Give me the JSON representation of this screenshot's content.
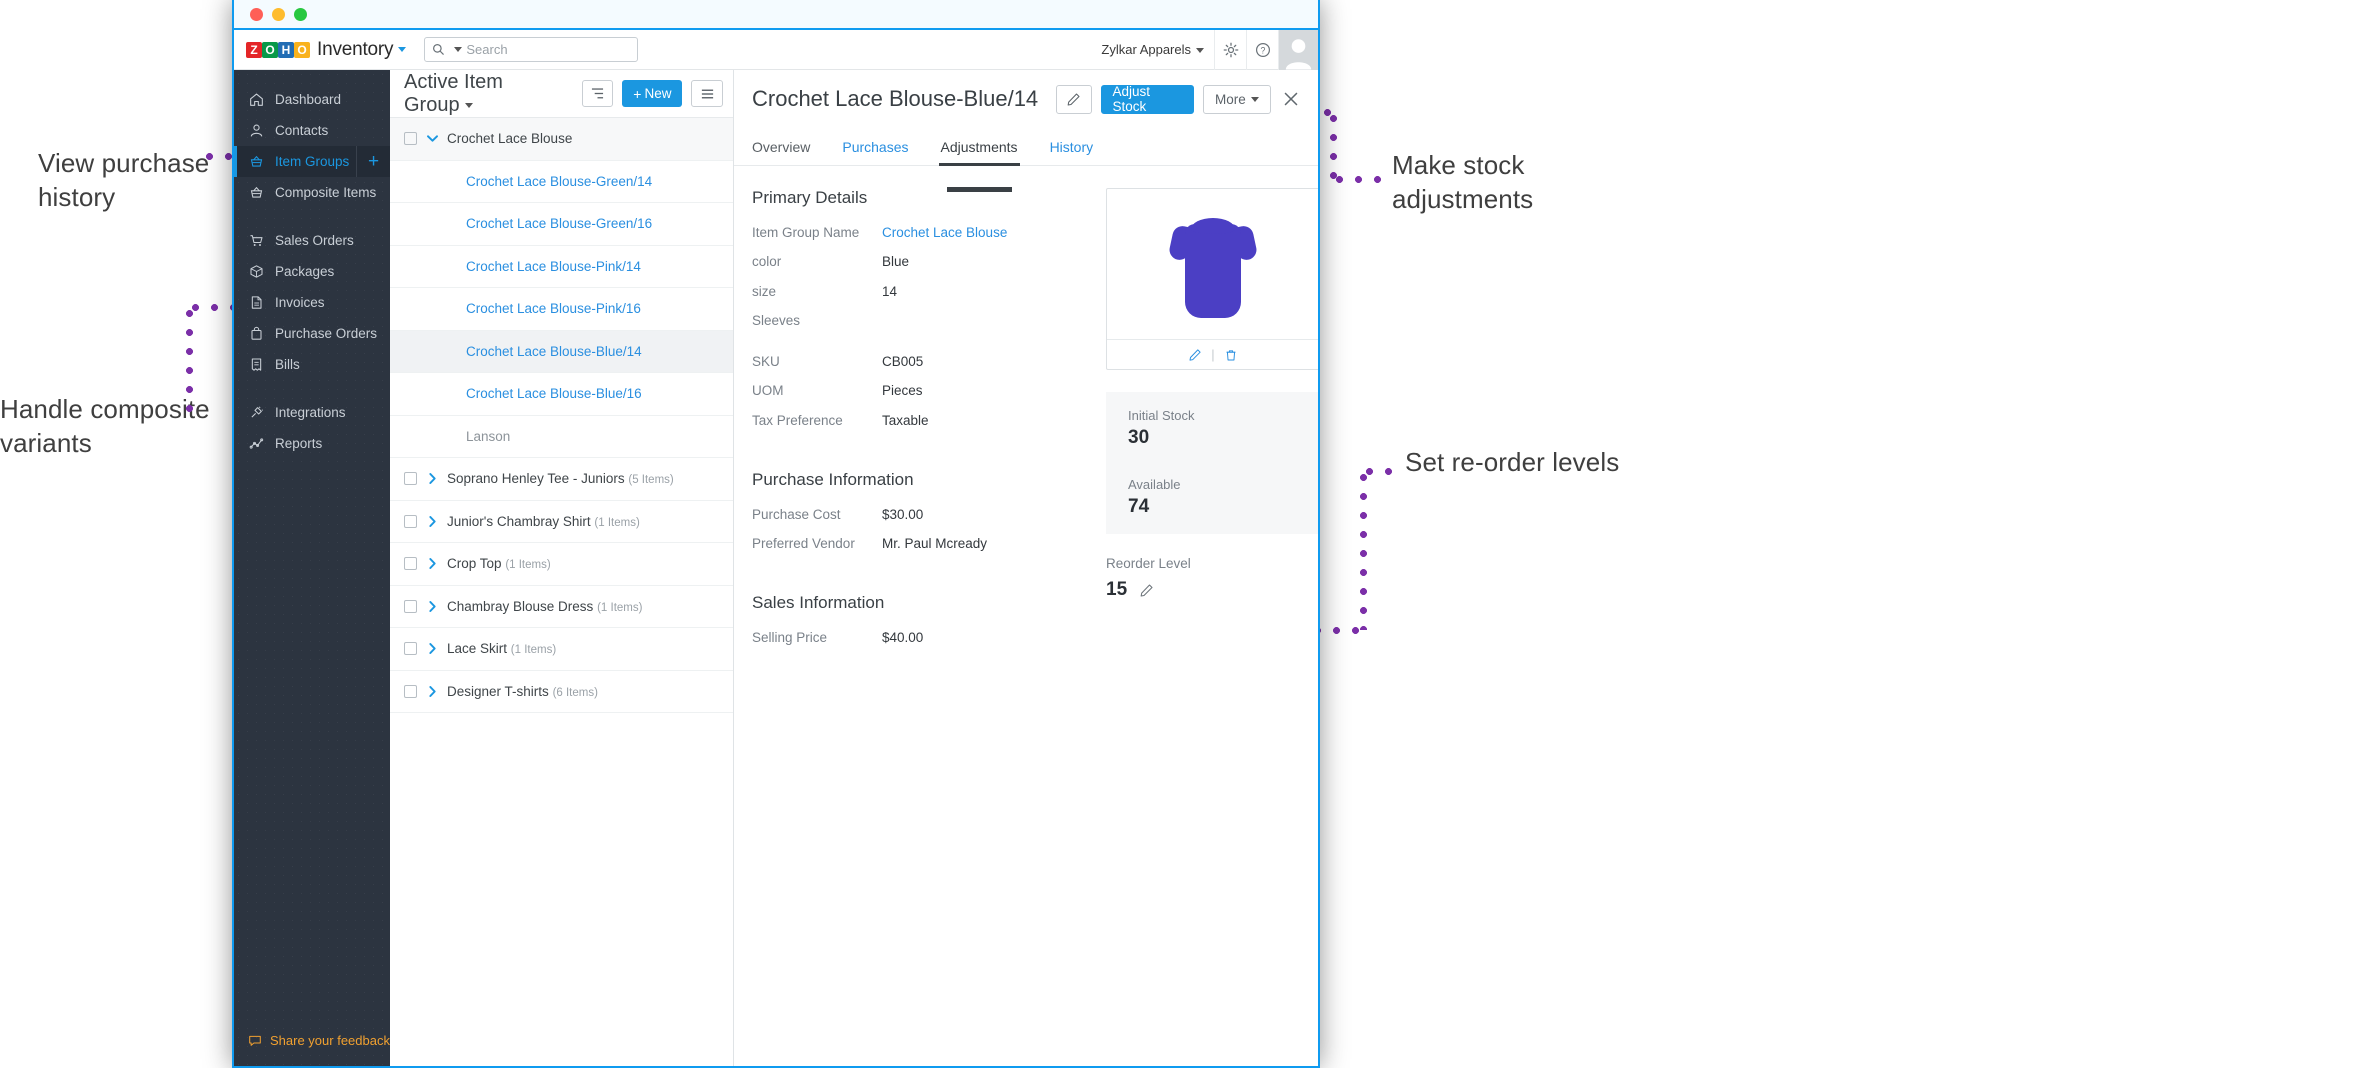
{
  "window": {
    "titlebar_buttons": [
      "close",
      "minimize",
      "maximize"
    ]
  },
  "appbar": {
    "logo_letters": [
      "Z",
      "O",
      "H",
      "O"
    ],
    "app_name": "Inventory",
    "search_placeholder": "Search",
    "org_name": "Zylkar Apparels",
    "icons": [
      "gear-icon",
      "help-icon",
      "avatar"
    ]
  },
  "sidebar": {
    "items": [
      {
        "label": "Dashboard",
        "icon": "home-icon",
        "active": false
      },
      {
        "label": "Contacts",
        "icon": "person-icon",
        "active": false
      },
      {
        "label": "Item Groups",
        "icon": "basket-icon",
        "active": true,
        "add_label": "+"
      },
      {
        "label": "Composite Items",
        "icon": "basket-icon",
        "active": false
      },
      {
        "label": "Sales Orders",
        "icon": "cart-icon",
        "active": false
      },
      {
        "label": "Packages",
        "icon": "box-icon",
        "active": false
      },
      {
        "label": "Invoices",
        "icon": "document-icon",
        "active": false
      },
      {
        "label": "Purchase Orders",
        "icon": "bag-icon",
        "active": false
      },
      {
        "label": "Bills",
        "icon": "receipt-icon",
        "active": false
      },
      {
        "label": "Integrations",
        "icon": "plug-icon",
        "active": false
      },
      {
        "label": "Reports",
        "icon": "chart-icon",
        "active": false
      }
    ],
    "feedback_label": "Share your feedback"
  },
  "list_panel": {
    "title": "Active Item Group",
    "new_button": "New",
    "rows": [
      {
        "name": "Crochet Lace Blouse",
        "type": "group-head",
        "checkbox": true,
        "expanded": true,
        "link": false
      },
      {
        "name": "Crochet Lace Blouse-Green/14",
        "type": "variant",
        "link": true
      },
      {
        "name": "Crochet Lace Blouse-Green/16",
        "type": "variant",
        "link": true
      },
      {
        "name": "Crochet Lace Blouse-Pink/14",
        "type": "variant",
        "link": true
      },
      {
        "name": "Crochet Lace Blouse-Pink/16",
        "type": "variant",
        "link": true
      },
      {
        "name": "Crochet Lace Blouse-Blue/14",
        "type": "variant",
        "link": true,
        "selected": true
      },
      {
        "name": "Crochet Lace Blouse-Blue/16",
        "type": "variant",
        "link": true
      },
      {
        "name": "Lanson",
        "type": "muted",
        "link": false
      },
      {
        "name": "Soprano Henley Tee - Juniors",
        "count": "(5 Items)",
        "type": "group",
        "checkbox": true,
        "link": false
      },
      {
        "name": "Junior's Chambray Shirt",
        "count": "(1 Items)",
        "type": "group",
        "checkbox": true,
        "link": false
      },
      {
        "name": "Crop Top",
        "count": "(1 Items)",
        "type": "group",
        "checkbox": true,
        "link": false
      },
      {
        "name": "Chambray Blouse Dress",
        "count": "(1 Items)",
        "type": "group",
        "checkbox": true,
        "link": false
      },
      {
        "name": "Lace Skirt",
        "count": "(1 Items)",
        "type": "group",
        "checkbox": true,
        "link": false
      },
      {
        "name": "Designer T-shirts",
        "count": "(6 Items)",
        "type": "group",
        "checkbox": true,
        "link": false
      }
    ]
  },
  "detail": {
    "title": "Crochet Lace Blouse-Blue/14",
    "edit_button": "edit-pencil",
    "adjust_stock_button": "Adjust Stock",
    "more_button": "More",
    "close_button": "close",
    "tabs": [
      {
        "label": "Overview",
        "active": false
      },
      {
        "label": "Purchases",
        "active": false
      },
      {
        "label": "Adjustments",
        "active": true
      },
      {
        "label": "History",
        "active": false
      }
    ],
    "primary_details": {
      "heading": "Primary Details",
      "fields": [
        {
          "label": "Item Group Name",
          "value": "Crochet Lace Blouse",
          "link": true
        },
        {
          "label": "color",
          "value": "Blue"
        },
        {
          "label": "size",
          "value": "14"
        },
        {
          "label": "Sleeves",
          "value": ""
        },
        {
          "label": "SKU",
          "value": "CB005"
        },
        {
          "label": "UOM",
          "value": "Pieces"
        },
        {
          "label": "Tax Preference",
          "value": "Taxable"
        }
      ]
    },
    "purchase_information": {
      "heading": "Purchase Information",
      "fields": [
        {
          "label": "Purchase Cost",
          "value": "$30.00"
        },
        {
          "label": "Preferred Vendor",
          "value": "Mr. Paul Mcready"
        }
      ]
    },
    "sales_information": {
      "heading": "Sales Information",
      "fields": [
        {
          "label": "Selling Price",
          "value": "$40.00"
        }
      ]
    },
    "image_card": {
      "image": "blue-dress-thumbnail",
      "edit_icon": "pencil-icon",
      "delete_icon": "trash-icon"
    },
    "stock_card": {
      "initial_stock_label": "Initial Stock",
      "initial_stock_value": "30",
      "available_label": "Available",
      "available_value": "74"
    },
    "reorder": {
      "label": "Reorder Level",
      "value": "15",
      "edit_icon": "pencil-icon"
    }
  },
  "annotations": [
    {
      "id": "view-purchase-history",
      "text": "View purchase\nhistory"
    },
    {
      "id": "handle-composite-variants",
      "text": "Handle composite\nvariants"
    },
    {
      "id": "make-stock-adjustments",
      "text": "Make stock\nadjustments"
    },
    {
      "id": "set-reorder-levels",
      "text": "Set re-order levels"
    }
  ],
  "colors": {
    "accent_blue": "#1b97e0",
    "annotation_purple": "#7b2fa8",
    "annotation_dot_pink": "#e6007e",
    "sidebar_bg": "#2c3440",
    "feedback_orange": "#f0a030"
  }
}
